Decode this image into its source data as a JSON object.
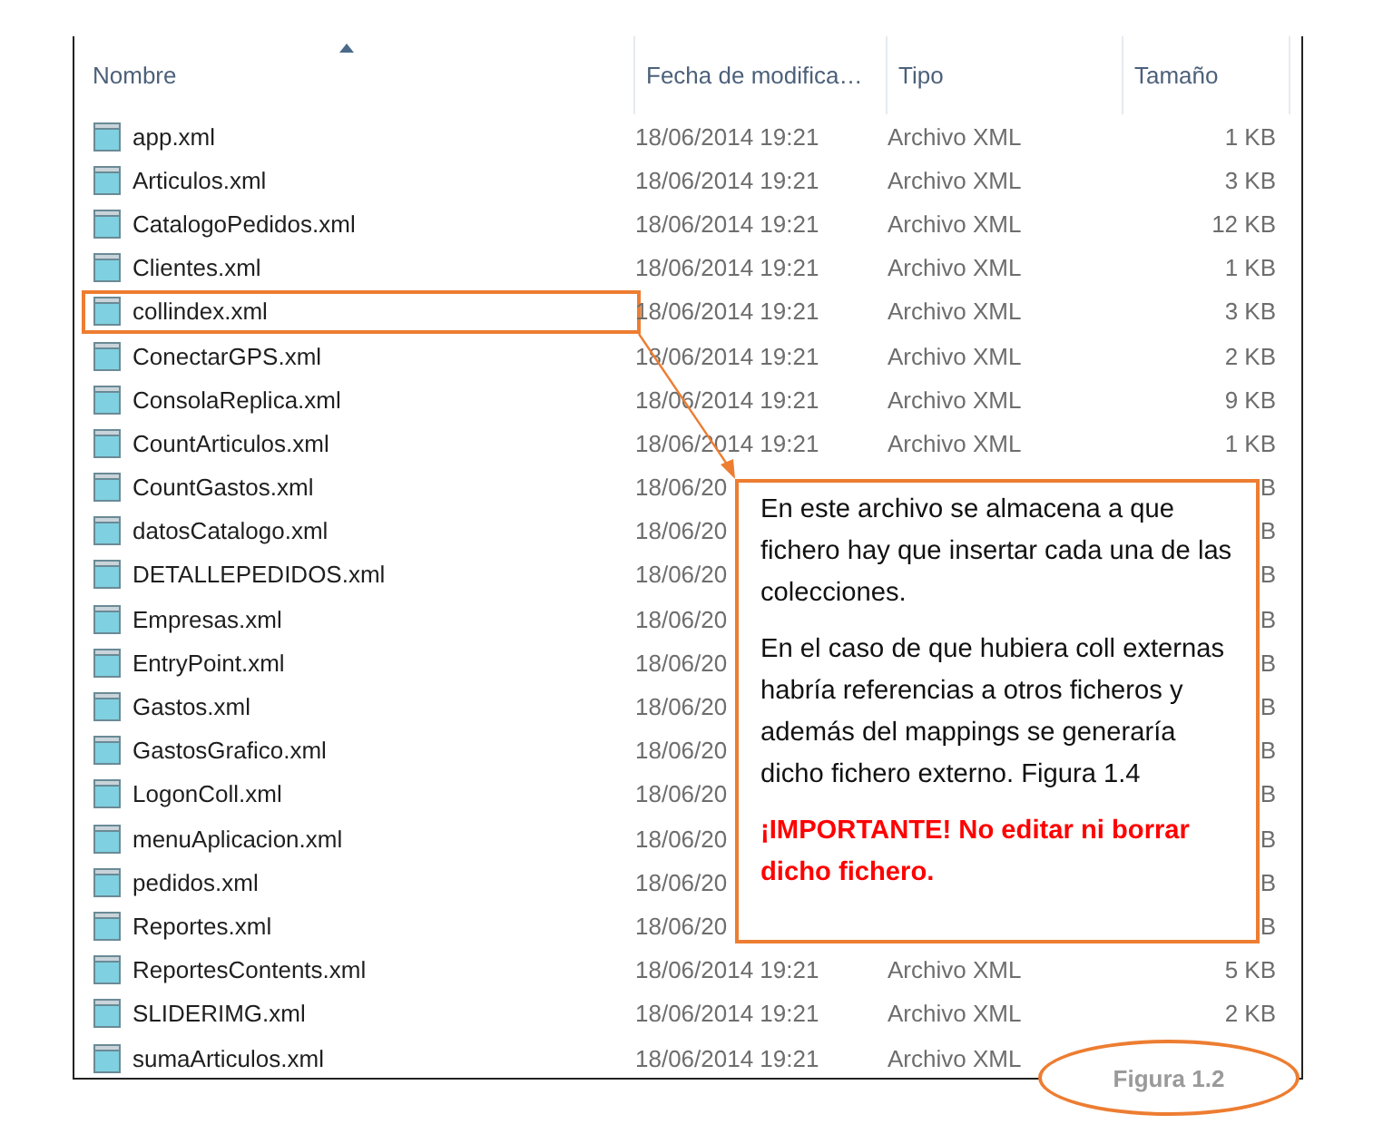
{
  "columns": [
    {
      "label": "Nombre",
      "sorted": true
    },
    {
      "label": "Fecha de modifica…",
      "sorted": false
    },
    {
      "label": "Tipo",
      "sorted": false
    },
    {
      "label": "Tamaño",
      "sorted": false
    }
  ],
  "rows": [
    {
      "name": "app.xml",
      "date": "18/06/2014 19:21",
      "type": "Archivo XML",
      "size": "1 KB",
      "highlighted": false
    },
    {
      "name": "Articulos.xml",
      "date": "18/06/2014 19:21",
      "type": "Archivo XML",
      "size": "3 KB",
      "highlighted": false
    },
    {
      "name": "CatalogoPedidos.xml",
      "date": "18/06/2014 19:21",
      "type": "Archivo XML",
      "size": "12 KB",
      "highlighted": false
    },
    {
      "name": "Clientes.xml",
      "date": "18/06/2014 19:21",
      "type": "Archivo XML",
      "size": "1 KB",
      "highlighted": false
    },
    {
      "name": "collindex.xml",
      "date": "18/06/2014 19:21",
      "type": "Archivo XML",
      "size": "3 KB",
      "highlighted": true
    },
    {
      "name": "ConectarGPS.xml",
      "date": "18/06/2014 19:21",
      "type": "Archivo XML",
      "size": "2 KB",
      "highlighted": false
    },
    {
      "name": "ConsolaReplica.xml",
      "date": "18/06/2014 19:21",
      "type": "Archivo XML",
      "size": "9 KB",
      "highlighted": false
    },
    {
      "name": "CountArticulos.xml",
      "date": "18/06/2014 19:21",
      "type": "Archivo XML",
      "size": "1 KB",
      "highlighted": false
    },
    {
      "name": "CountGastos.xml",
      "date": "18/06/20",
      "size": "B",
      "highlighted": false
    },
    {
      "name": "datosCatalogo.xml",
      "date": "18/06/20",
      "size": "B",
      "highlighted": false
    },
    {
      "name": "DETALLEPEDIDOS.xml",
      "date": "18/06/20",
      "size": "B",
      "highlighted": false
    },
    {
      "name": "Empresas.xml",
      "date": "18/06/20",
      "size": "B",
      "highlighted": false
    },
    {
      "name": "EntryPoint.xml",
      "date": "18/06/20",
      "size": "B",
      "highlighted": false
    },
    {
      "name": "Gastos.xml",
      "date": "18/06/20",
      "size": "B",
      "highlighted": false
    },
    {
      "name": "GastosGrafico.xml",
      "date": "18/06/20",
      "size": "B",
      "highlighted": false
    },
    {
      "name": "LogonColl.xml",
      "date": "18/06/20",
      "size": "B",
      "highlighted": false
    },
    {
      "name": "menuAplicacion.xml",
      "date": "18/06/20",
      "size": "B",
      "highlighted": false
    },
    {
      "name": "pedidos.xml",
      "date": "18/06/20",
      "size": "B",
      "highlighted": false
    },
    {
      "name": "Reportes.xml",
      "date": "18/06/20",
      "size": "B",
      "highlighted": false
    },
    {
      "name": "ReportesContents.xml",
      "date": "18/06/2014 19:21",
      "type": "Archivo XML",
      "size": "5 KB",
      "highlighted": false
    },
    {
      "name": "SLIDERIMG.xml",
      "date": "18/06/2014 19:21",
      "type": "Archivo XML",
      "size": "2 KB",
      "highlighted": false
    },
    {
      "name": "sumaArticulos.xml",
      "date": "18/06/2014 19:21",
      "type": "Archivo XML",
      "highlighted": false
    }
  ],
  "callout": {
    "paragraphs": [
      {
        "kind": "normal",
        "text": "En este archivo se almacena a que fichero hay que insertar cada una de las colecciones."
      },
      {
        "kind": "normal",
        "text": "En el caso de que hubiera coll externas habría referencias a otros ficheros y además del mappings se generaría dicho fichero externo. Figura 1.4"
      },
      {
        "kind": "warning",
        "text": "¡IMPORTANTE! No editar ni borrar dicho fichero."
      }
    ]
  },
  "caption": "Figura 1.2"
}
